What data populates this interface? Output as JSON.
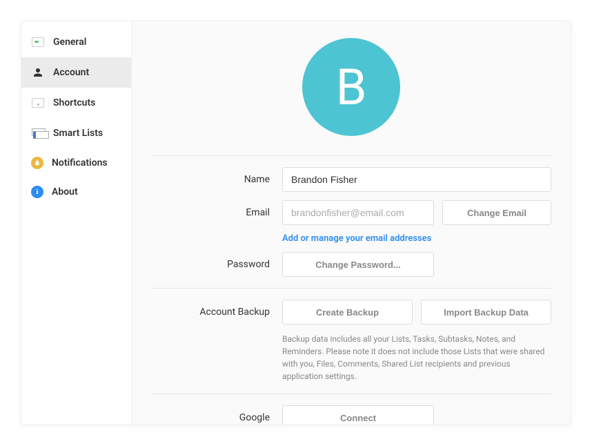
{
  "sidebar": {
    "items": [
      {
        "label": "General"
      },
      {
        "label": "Account"
      },
      {
        "label": "Shortcuts"
      },
      {
        "label": "Smart Lists"
      },
      {
        "label": "Notifications"
      },
      {
        "label": "About"
      }
    ]
  },
  "avatar": {
    "initial": "B",
    "bg": "#4dc4d2"
  },
  "profile": {
    "name_label": "Name",
    "name_value": "Brandon Fisher",
    "email_label": "Email",
    "email_value": "brandonfisher@email.com",
    "change_email_label": "Change Email",
    "manage_emails_link": "Add or manage your email addresses",
    "password_label": "Password",
    "change_password_label": "Change Password..."
  },
  "backup": {
    "section_label": "Account Backup",
    "create_label": "Create Backup",
    "import_label": "Import Backup Data",
    "hint": "Backup data includes all your Lists, Tasks, Subtasks, Notes, and Reminders. Please note it does not include those Lists that were shared with you, Files, Comments, Shared List recipients and previous application settings."
  },
  "google": {
    "section_label": "Google",
    "connect_label": "Connect"
  },
  "about_glyph": "i"
}
